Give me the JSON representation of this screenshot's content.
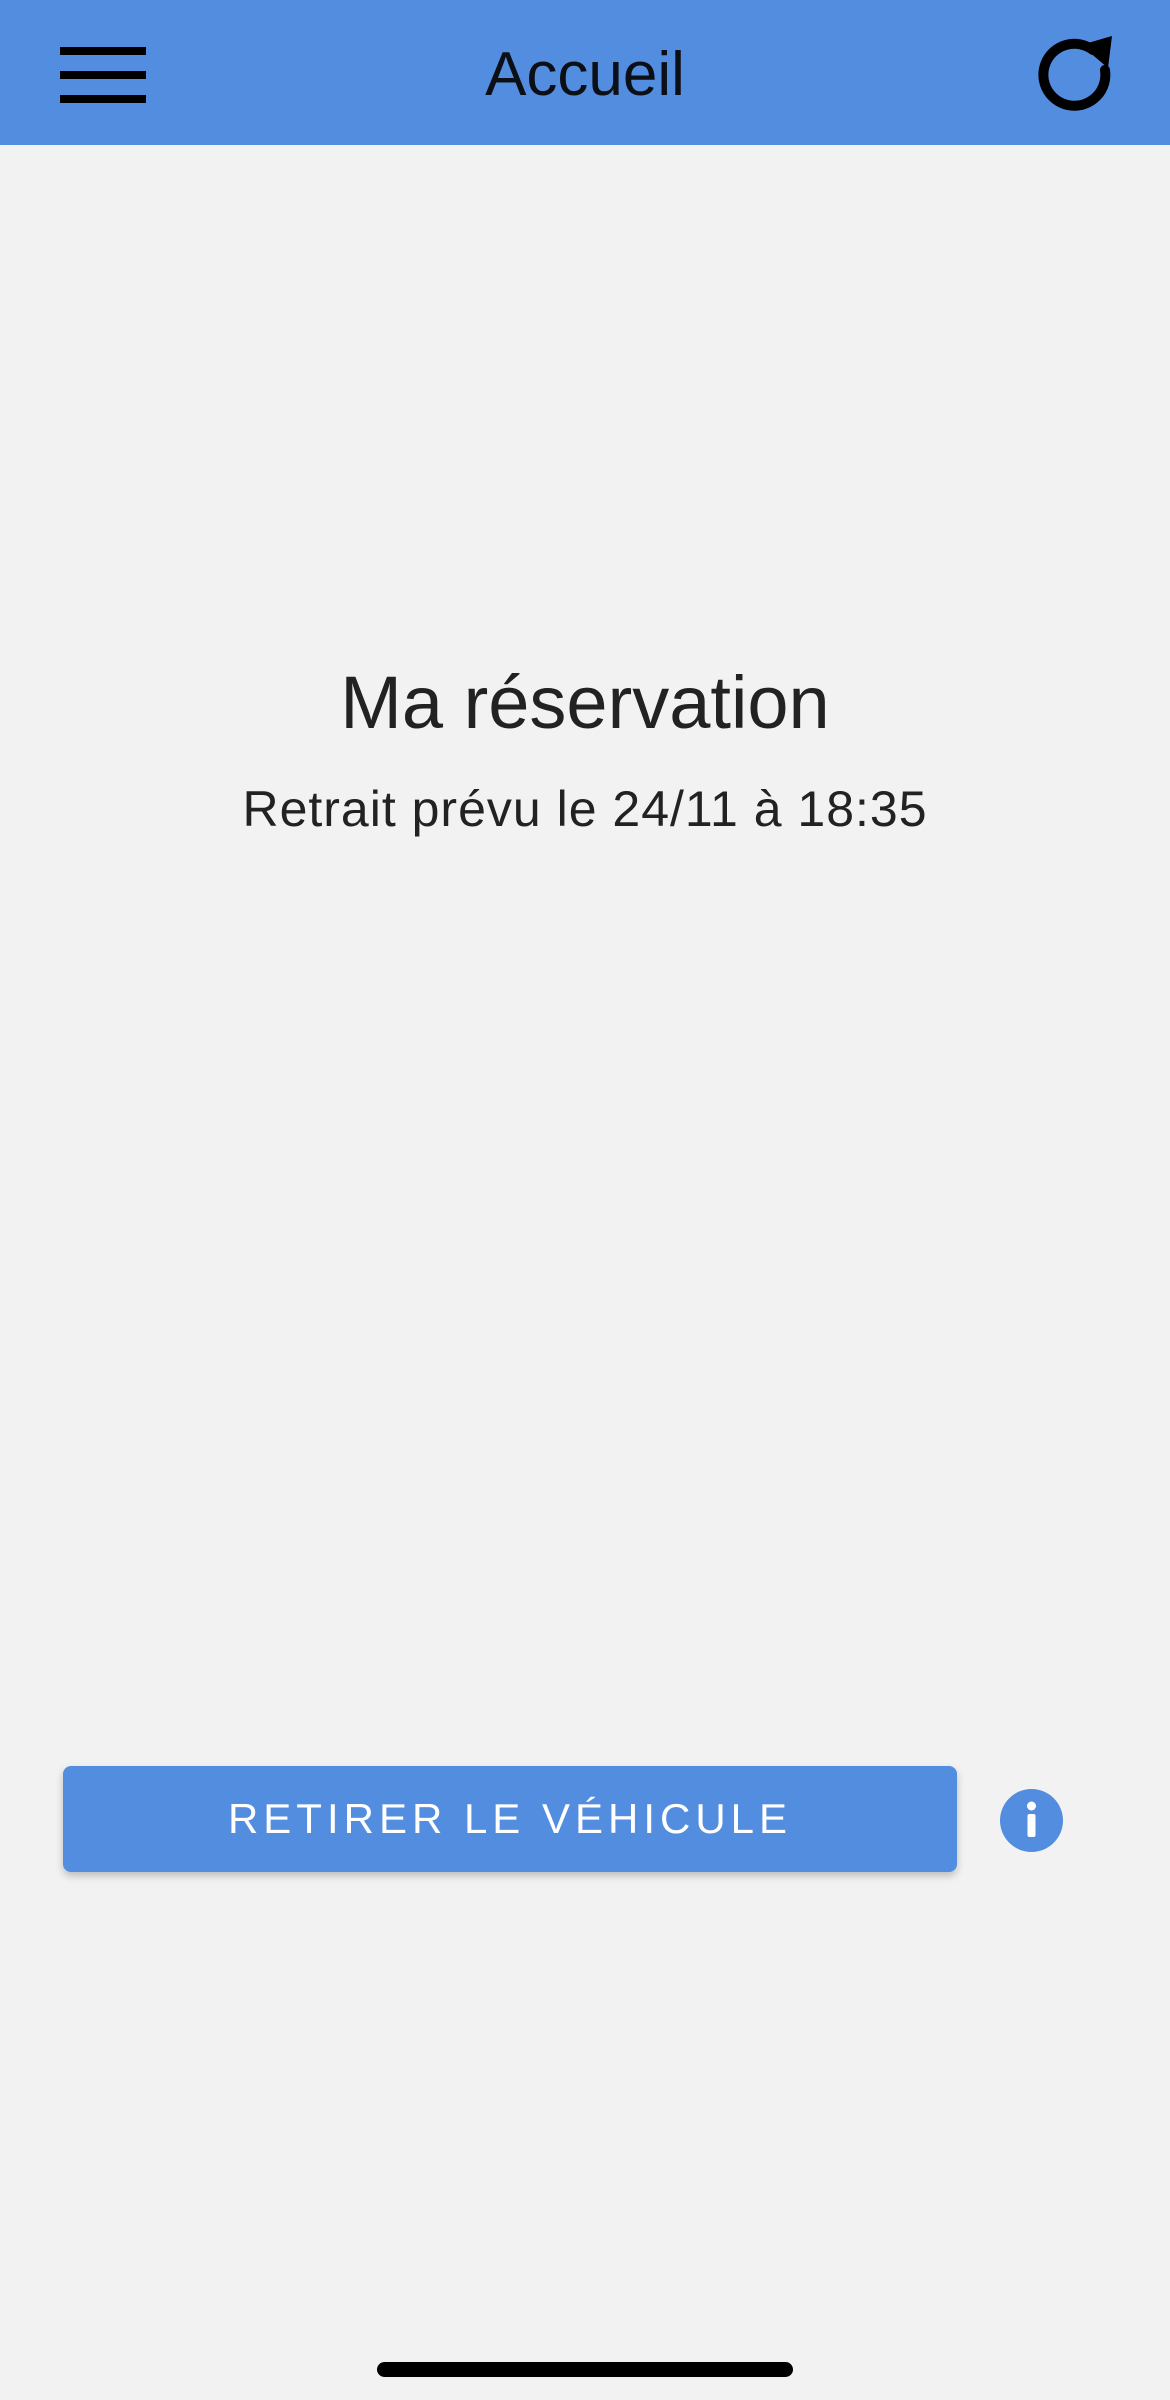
{
  "app_bar": {
    "title": "Accueil",
    "menu_icon": "hamburger-menu-icon",
    "refresh_icon": "refresh-icon",
    "background_color": "#538ddf"
  },
  "reservation": {
    "title": "Ma réservation",
    "subtitle": "Retrait prévu le 24/11 à 18:35"
  },
  "actions": {
    "withdraw_label": "RETIRER LE VÉHICULE",
    "info_icon": "info-icon",
    "button_color": "#538ddf"
  },
  "colors": {
    "background": "#f2f2f2",
    "text": "#222222"
  }
}
